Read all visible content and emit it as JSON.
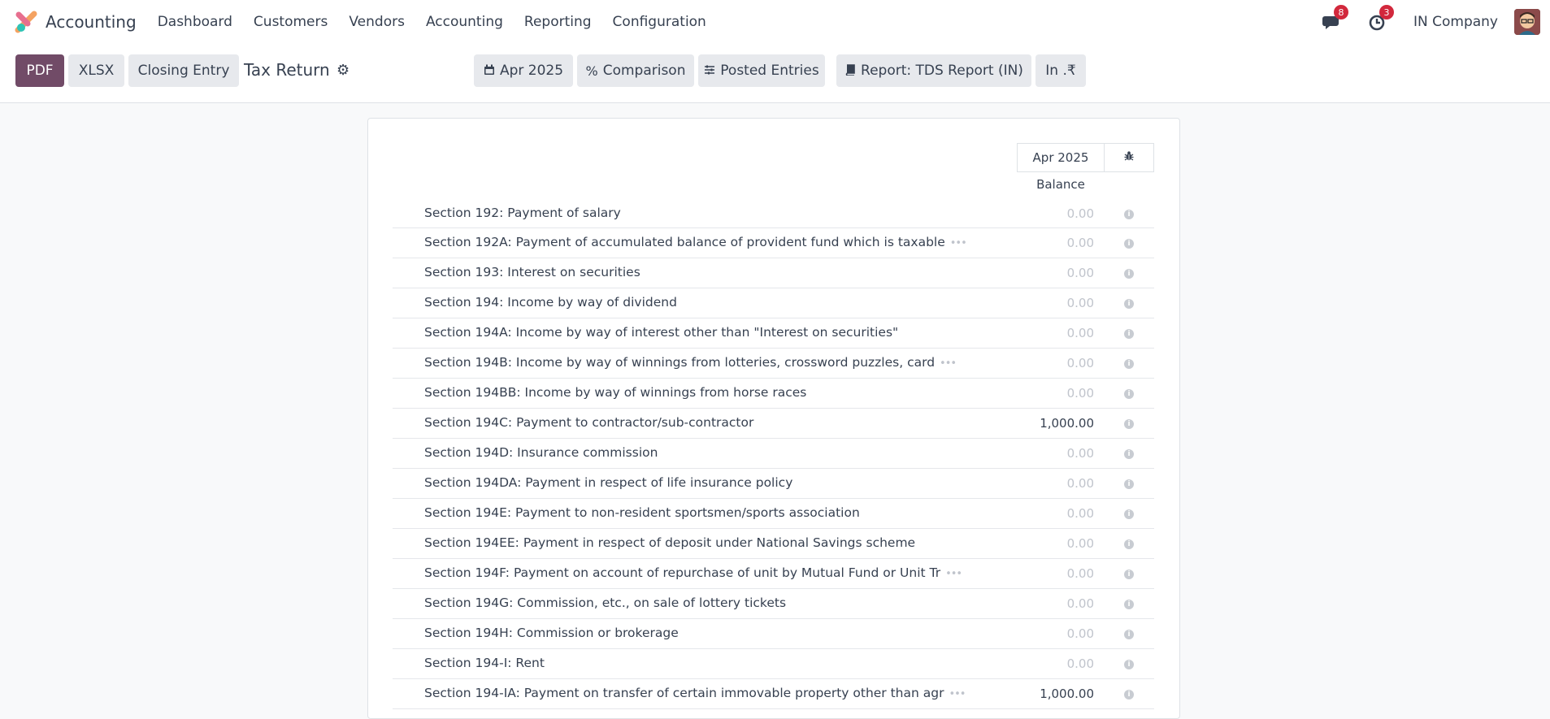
{
  "app": {
    "name": "Accounting",
    "menu": [
      "Dashboard",
      "Customers",
      "Vendors",
      "Accounting",
      "Reporting",
      "Configuration"
    ],
    "messages_count": "8",
    "activities_count": "3",
    "company": "IN Company"
  },
  "toolbar": {
    "pdf_label": "PDF",
    "xlsx_label": "XLSX",
    "closing_entry_label": "Closing Entry",
    "title": "Tax Return",
    "filters": {
      "date": "Apr 2025",
      "comparison": "Comparison",
      "posted": "Posted Entries",
      "report": "Report: TDS Report (IN)",
      "currency": "In .₹"
    }
  },
  "report": {
    "column_header": "Apr 2025",
    "column_subheader": "Balance",
    "rows": [
      {
        "label": "Section 192: Payment of salary",
        "value": "0.00",
        "truncated": false
      },
      {
        "label": "Section 192A: Payment of accumulated balance of provident fund which is taxable",
        "value": "0.00",
        "truncated": true
      },
      {
        "label": "Section 193: Interest on securities",
        "value": "0.00",
        "truncated": false
      },
      {
        "label": "Section 194: Income by way of dividend",
        "value": "0.00",
        "truncated": false
      },
      {
        "label": "Section 194A: Income by way of interest other than \"Interest on securities\"",
        "value": "0.00",
        "truncated": false
      },
      {
        "label": "Section 194B: Income by way of winnings from lotteries, crossword puzzles, card",
        "value": "0.00",
        "truncated": true
      },
      {
        "label": "Section 194BB: Income by way of winnings from horse races",
        "value": "0.00",
        "truncated": false
      },
      {
        "label": "Section 194C: Payment to contractor/sub-contractor",
        "value": "1,000.00",
        "truncated": false
      },
      {
        "label": "Section 194D: Insurance commission",
        "value": "0.00",
        "truncated": false
      },
      {
        "label": "Section 194DA: Payment in respect of life insurance policy",
        "value": "0.00",
        "truncated": false
      },
      {
        "label": "Section 194E: Payment to non-resident sportsmen/sports association",
        "value": "0.00",
        "truncated": false
      },
      {
        "label": "Section 194EE: Payment in respect of deposit under National Savings scheme",
        "value": "0.00",
        "truncated": false
      },
      {
        "label": "Section 194F: Payment on account of repurchase of unit by Mutual Fund or Unit Tr",
        "value": "0.00",
        "truncated": true
      },
      {
        "label": "Section 194G: Commission, etc., on sale of lottery tickets",
        "value": "0.00",
        "truncated": false
      },
      {
        "label": "Section 194H: Commission or brokerage",
        "value": "0.00",
        "truncated": false
      },
      {
        "label": "Section 194-I: Rent",
        "value": "0.00",
        "truncated": false
      },
      {
        "label": "Section 194-IA: Payment on transfer of certain immovable property other than agr",
        "value": "1,000.00",
        "truncated": true
      }
    ]
  },
  "colors": {
    "primary": "#714b67",
    "badge": "#d2283c",
    "muted_value": "#c0c4cc"
  }
}
